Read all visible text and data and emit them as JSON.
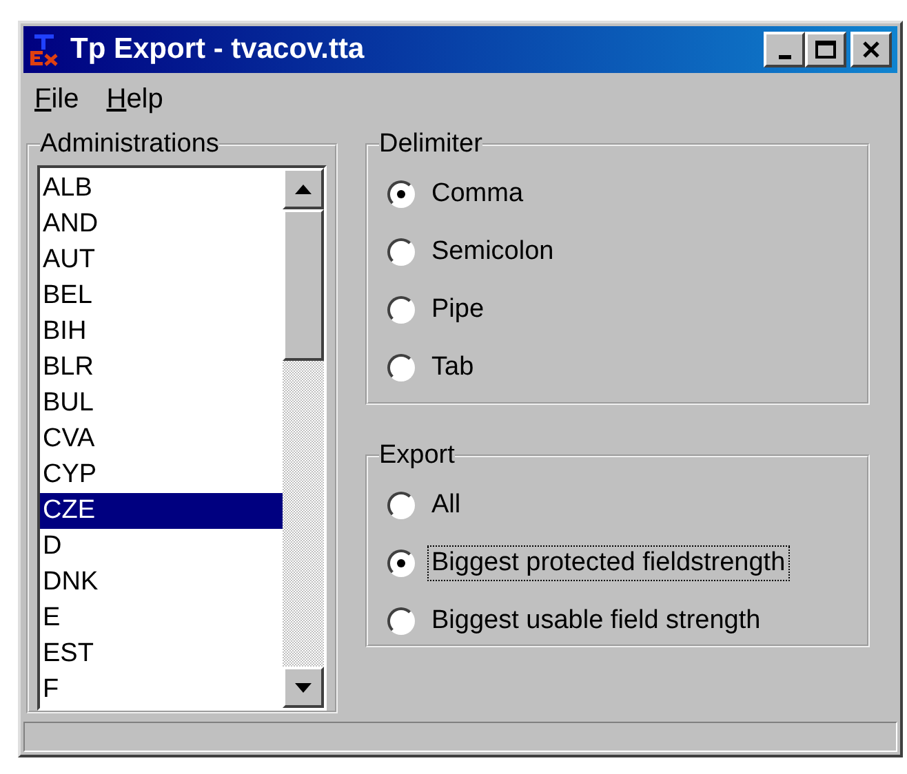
{
  "window": {
    "title": "Tp Export - tvacov.tta"
  },
  "menu": [
    {
      "label": "File"
    },
    {
      "label": "Help"
    }
  ],
  "administrations": {
    "label": "Administrations",
    "items": [
      {
        "label": "ALB",
        "selected": false
      },
      {
        "label": "AND",
        "selected": false
      },
      {
        "label": "AUT",
        "selected": false
      },
      {
        "label": "BEL",
        "selected": false
      },
      {
        "label": "BIH",
        "selected": false
      },
      {
        "label": "BLR",
        "selected": false
      },
      {
        "label": "BUL",
        "selected": false
      },
      {
        "label": "CVA",
        "selected": false
      },
      {
        "label": "CYP",
        "selected": false
      },
      {
        "label": "CZE",
        "selected": true
      },
      {
        "label": "D",
        "selected": false
      },
      {
        "label": "DNK",
        "selected": false
      },
      {
        "label": "E",
        "selected": false
      },
      {
        "label": "EST",
        "selected": false
      },
      {
        "label": "F",
        "selected": false
      }
    ]
  },
  "delimiter": {
    "label": "Delimiter",
    "options": [
      {
        "label": "Comma",
        "selected": true
      },
      {
        "label": "Semicolon",
        "selected": false
      },
      {
        "label": "Pipe",
        "selected": false
      },
      {
        "label": "Tab",
        "selected": false
      }
    ]
  },
  "export": {
    "label": "Export",
    "options": [
      {
        "label": "All",
        "selected": false,
        "focused": false
      },
      {
        "label": "Biggest protected fieldstrength",
        "selected": true,
        "focused": true
      },
      {
        "label": "Biggest usable field strength",
        "selected": false,
        "focused": false
      }
    ]
  }
}
